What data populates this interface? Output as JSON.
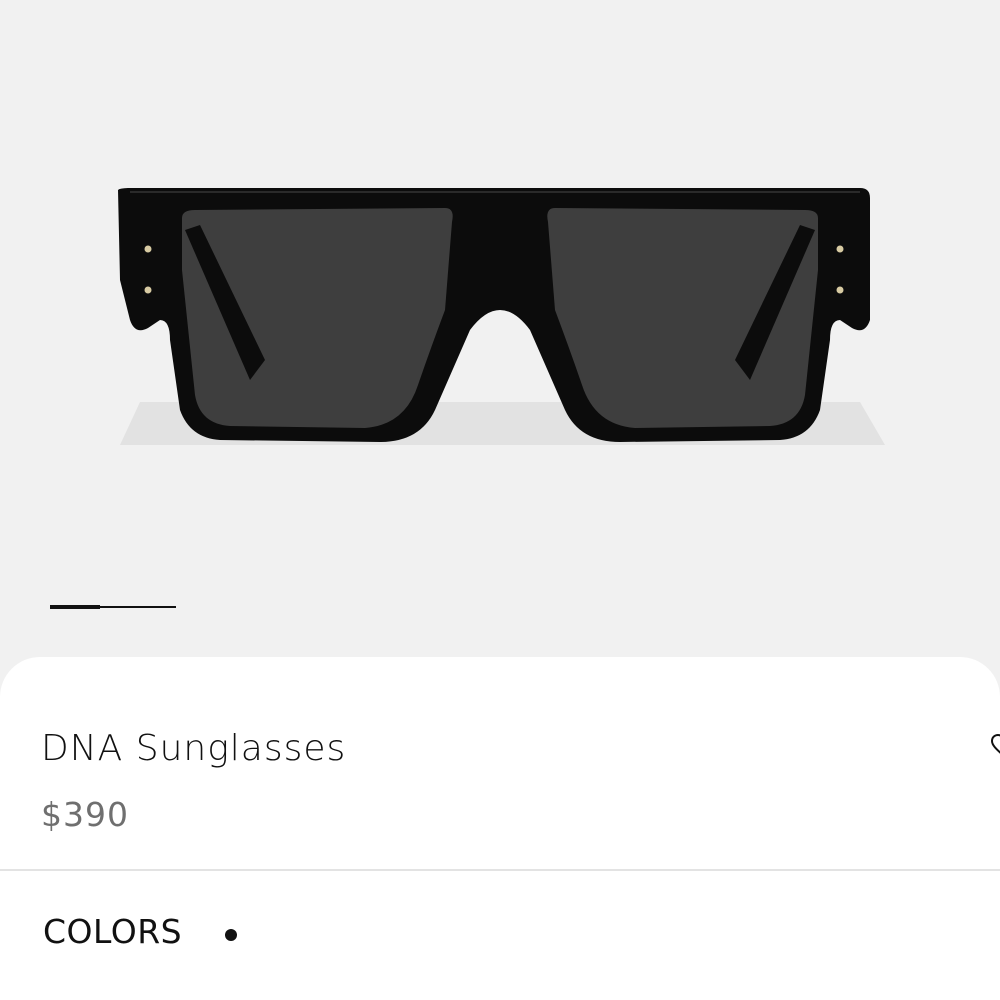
{
  "product": {
    "title": "DNA Sunglasses",
    "price": "$390",
    "image_alt": "sunglasses-product-image"
  },
  "gallery": {
    "active_slide": 1,
    "indicator_color": "#111111"
  },
  "colors": {
    "label": "COLORS",
    "options": [
      {
        "name": "black",
        "hex": "#111111",
        "selected": true
      }
    ]
  },
  "icons": {
    "wishlist": "heart-icon"
  },
  "theme": {
    "background": "#f1f1f1",
    "sheet": "#ffffff",
    "price_color": "#6f6f6f"
  }
}
